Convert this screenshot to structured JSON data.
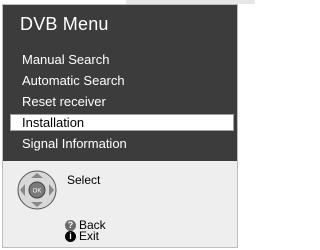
{
  "menu": {
    "title": "DVB Menu",
    "items": [
      {
        "label": "Manual Search",
        "selected": false
      },
      {
        "label": "Automatic Search",
        "selected": false
      },
      {
        "label": "Reset receiver",
        "selected": false
      },
      {
        "label": "Installation",
        "selected": true
      },
      {
        "label": "Signal Information",
        "selected": false
      }
    ]
  },
  "legend": {
    "select_label": "Select",
    "ok_key_label": "OK",
    "back_label": "Back",
    "exit_label": "Exit",
    "back_key_glyph": "?",
    "exit_key_glyph": "i"
  },
  "colors": {
    "panel_bg": "#3c3c3c",
    "selection_bg": "#ffffff",
    "legend_bg": "#eeeeee"
  }
}
